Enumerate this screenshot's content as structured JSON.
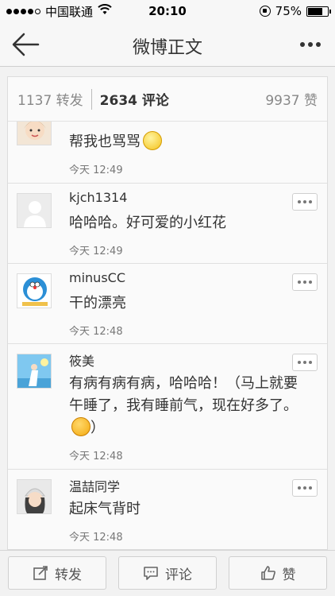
{
  "status_bar": {
    "carrier": "中国联通",
    "time": "20:10",
    "battery": "75%",
    "battery_level": 0.75
  },
  "nav": {
    "title": "微博正文"
  },
  "tabs": {
    "repost_count": "1137",
    "repost_label": "转发",
    "comment_count": "2634",
    "comment_label": "评论",
    "like_count": "9937",
    "like_label": "赞"
  },
  "comments": [
    {
      "name": "",
      "text": "帮我也骂骂",
      "emoji": "shy",
      "time": "今天 12:49"
    },
    {
      "name": "kjch1314",
      "text": "哈哈哈。好可爱的小红花",
      "emoji": "",
      "time": "今天 12:49"
    },
    {
      "name": "minusCC",
      "text": "干的漂亮",
      "emoji": "",
      "time": "今天 12:48"
    },
    {
      "name": "筱美",
      "text": "有病有病有病，哈哈哈！（马上就要午睡了，我有睡前气，现在好多了。",
      "text_end": "）",
      "emoji": "laugh",
      "time": "今天 12:48"
    },
    {
      "name": "温喆同学",
      "text": "起床气背时",
      "emoji": "",
      "time": "今天 12:48"
    }
  ],
  "toolbar": {
    "repost": "转发",
    "comment": "评论",
    "like": "赞"
  },
  "colors": {
    "background": "#f2f2f2",
    "card": "#ffffff",
    "text": "#333333",
    "muted": "#888888"
  }
}
